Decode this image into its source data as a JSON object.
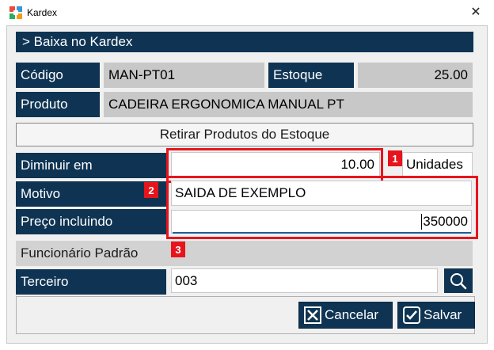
{
  "window": {
    "title": "Kardex",
    "close_glyph": "✕",
    "icon": "kardex-app-icon"
  },
  "header": {
    "title": "> Baixa no Kardex"
  },
  "fields": {
    "codigo_label": "Código",
    "codigo_value": "MAN-PT01",
    "estoque_label": "Estoque",
    "estoque_value": "25.00",
    "produto_label": "Produto",
    "produto_value": "CADEIRA ERGONOMICA MANUAL PT"
  },
  "section_button": {
    "label": "Retirar Produtos do Estoque"
  },
  "form": {
    "diminuir_label": "Diminuir em",
    "diminuir_value": "10.00",
    "unidades_label": "Unidades",
    "motivo_label": "Motivo",
    "motivo_value": "SAIDA DE EXEMPLO",
    "preco_label": "Preço incluindo",
    "preco_value": "350000",
    "funcionario_label": "Funcionário Padrão",
    "terceiro_label": "Terceiro",
    "terceiro_value": "003"
  },
  "badges": {
    "one": "1",
    "two": "2",
    "three": "3"
  },
  "buttons": {
    "cancelar_label": "Cancelar",
    "salvar_label": "Salvar"
  },
  "colors": {
    "navy": "#0f3453",
    "highlight_red": "#e8141c",
    "gray_field": "#c8c8c8"
  },
  "icons": [
    "kardex-app-icon",
    "close-icon",
    "search-icon",
    "cancel-x-icon",
    "save-check-icon"
  ]
}
